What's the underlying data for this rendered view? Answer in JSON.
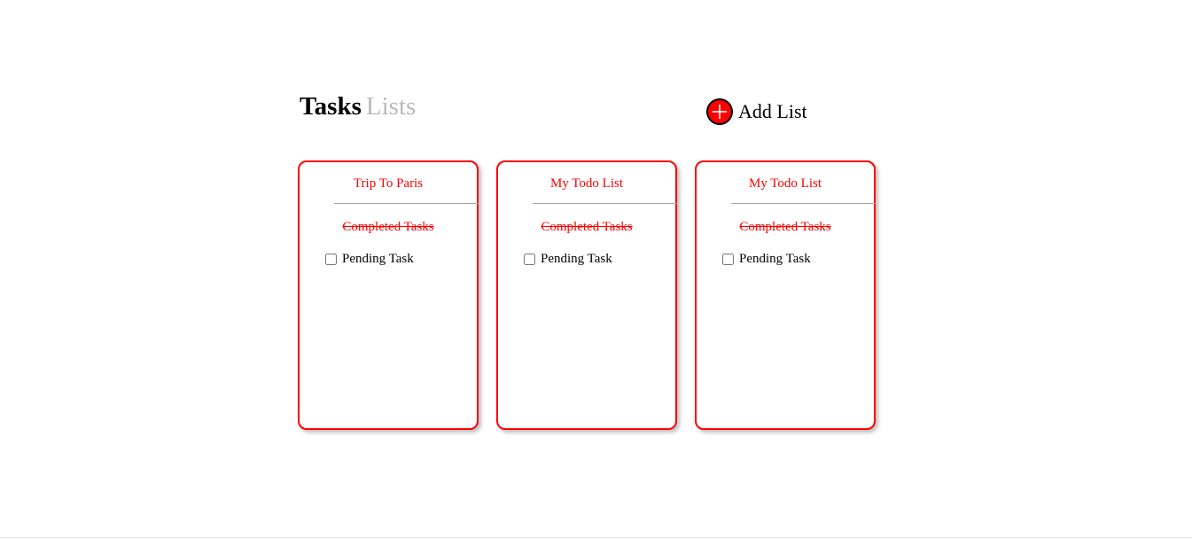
{
  "header": {
    "tabs": [
      {
        "label": "Tasks",
        "active": true
      },
      {
        "label": "Lists",
        "active": false
      }
    ],
    "add_list_label": "Add List",
    "add_icon": "plus-icon"
  },
  "colors": {
    "accent": "#ff0000",
    "inactive_tab": "#b9b9b9",
    "divider": "#a6a6a6"
  },
  "lists": [
    {
      "title": "Trip To Paris",
      "completed_label": "Completed Tasks",
      "pending_label": "Pending Task",
      "pending_checked": false
    },
    {
      "title": "My Todo List",
      "completed_label": "Completed Tasks",
      "pending_label": "Pending Task",
      "pending_checked": false
    },
    {
      "title": "My Todo List",
      "completed_label": "Completed Tasks",
      "pending_label": "Pending Task",
      "pending_checked": false
    }
  ]
}
